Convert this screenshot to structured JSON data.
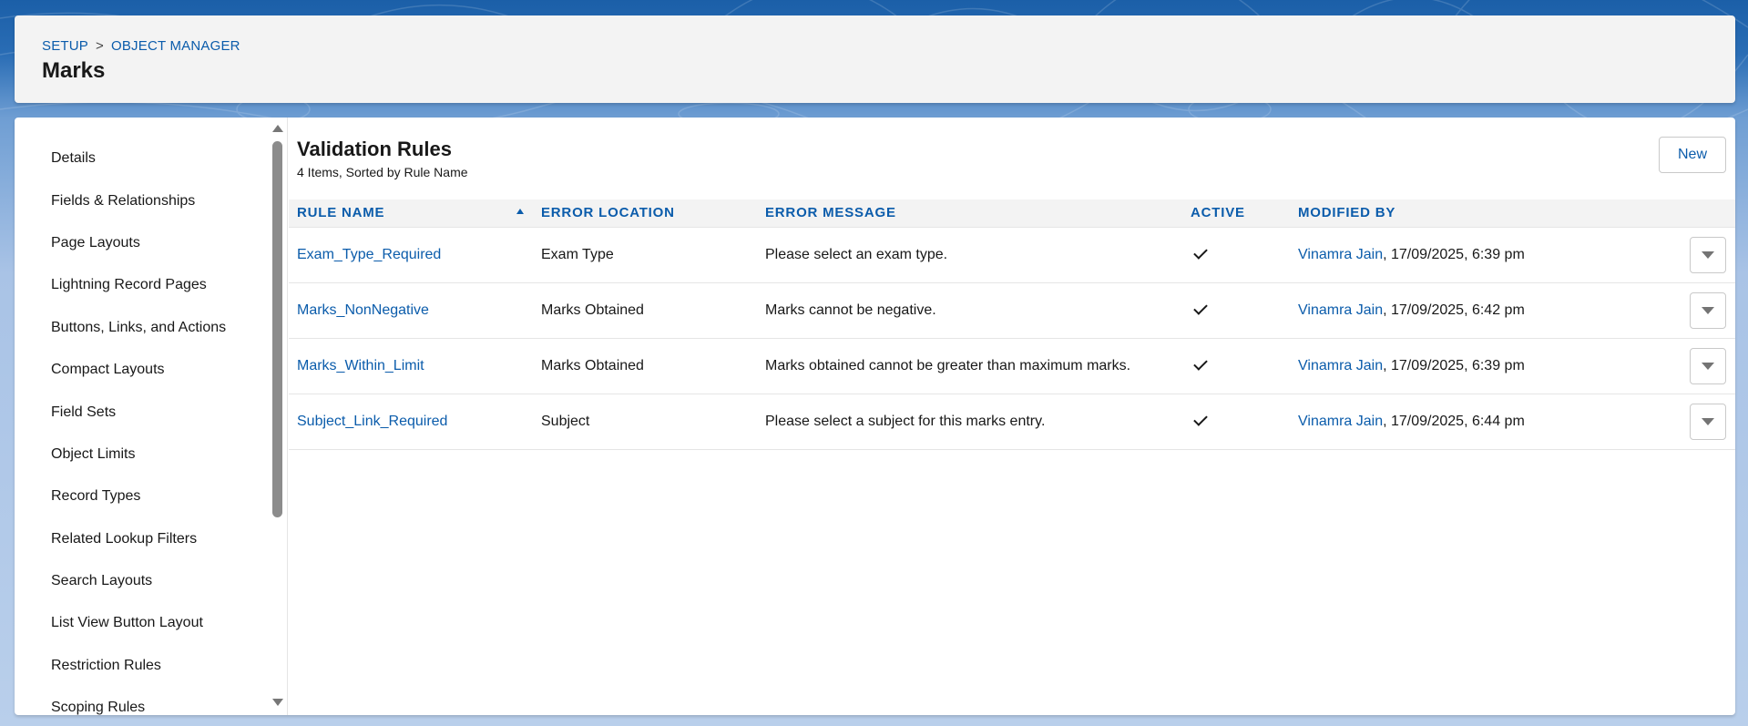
{
  "breadcrumb": {
    "setup": "SETUP",
    "separator": ">",
    "object_manager": "OBJECT MANAGER"
  },
  "page_title": "Marks",
  "sidebar": {
    "items": [
      {
        "label": "Details"
      },
      {
        "label": "Fields & Relationships"
      },
      {
        "label": "Page Layouts"
      },
      {
        "label": "Lightning Record Pages"
      },
      {
        "label": "Buttons, Links, and Actions"
      },
      {
        "label": "Compact Layouts"
      },
      {
        "label": "Field Sets"
      },
      {
        "label": "Object Limits"
      },
      {
        "label": "Record Types"
      },
      {
        "label": "Related Lookup Filters"
      },
      {
        "label": "Search Layouts"
      },
      {
        "label": "List View Button Layout"
      },
      {
        "label": "Restriction Rules"
      },
      {
        "label": "Scoping Rules"
      }
    ]
  },
  "content": {
    "title": "Validation Rules",
    "subtitle": "4 Items, Sorted by Rule Name",
    "new_label": "New",
    "columns": {
      "rule_name": "RULE NAME",
      "error_location": "ERROR LOCATION",
      "error_message": "ERROR MESSAGE",
      "active": "ACTIVE",
      "modified_by": "MODIFIED BY"
    },
    "rows": [
      {
        "rule_name": "Exam_Type_Required",
        "error_location": "Exam Type",
        "error_message": "Please select an exam type.",
        "active": true,
        "modified_user": "Vinamra Jain",
        "modified_date": ", 17/09/2025, 6:39 pm"
      },
      {
        "rule_name": "Marks_NonNegative",
        "error_location": "Marks Obtained",
        "error_message": "Marks cannot be negative.",
        "active": true,
        "modified_user": "Vinamra Jain",
        "modified_date": ", 17/09/2025, 6:42 pm"
      },
      {
        "rule_name": "Marks_Within_Limit",
        "error_location": "Marks Obtained",
        "error_message": "Marks obtained cannot be greater than maximum marks.",
        "active": true,
        "modified_user": "Vinamra Jain",
        "modified_date": ", 17/09/2025, 6:39 pm"
      },
      {
        "rule_name": "Subject_Link_Required",
        "error_location": "Subject",
        "error_message": "Please select a subject for this marks entry.",
        "active": true,
        "modified_user": "Vinamra Jain",
        "modified_date": ", 17/09/2025, 6:44 pm"
      }
    ]
  },
  "colors": {
    "link": "#0b5cab",
    "header_bg": "#f3f3f3",
    "brand_blue": "#1b5fa8"
  },
  "icons": {
    "sort": "sort-ascending-icon",
    "check": "check-icon",
    "row_menu": "chevron-down-icon"
  }
}
